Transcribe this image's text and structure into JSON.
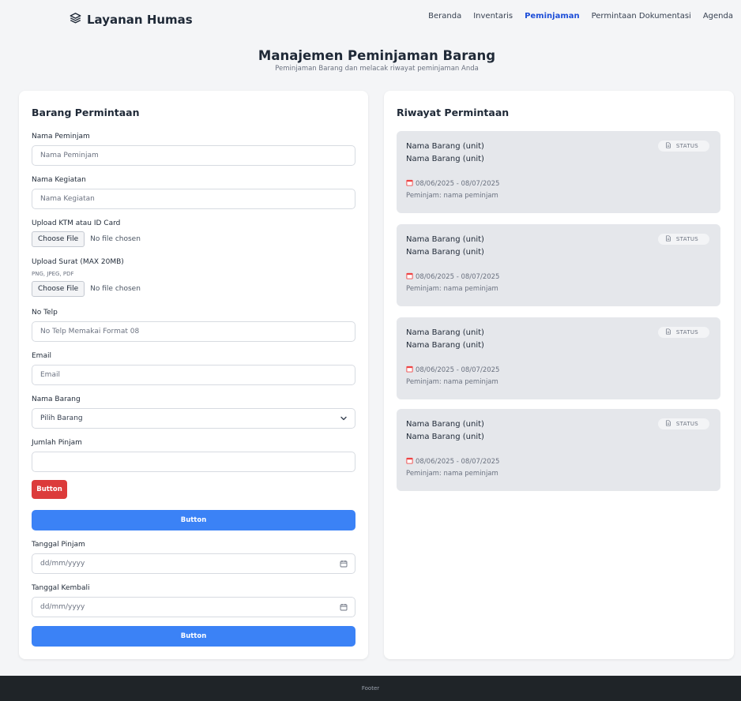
{
  "navbar": {
    "brand": "Layanan Humas",
    "links": [
      "Beranda",
      "Inventaris",
      "Peminjaman",
      "Permintaan Dokumentasi",
      "Agenda"
    ],
    "active_index": 2
  },
  "header": {
    "title": "Manajemen Peminjaman Barang",
    "subtitle": "Peminjaman Barang dan melacak riwayat peminjaman Anda"
  },
  "form": {
    "title": "Barang Permintaan",
    "borrower_label": "Nama Peminjam",
    "borrower_placeholder": "Nama Peminjam",
    "activity_label": "Nama Kegiatan",
    "activity_placeholder": "Nama Kegiatan",
    "ktm_label": "Upload KTM atau ID Card",
    "choose_file": "Choose File",
    "no_file": "No file chosen",
    "letter_label": "Upload Surat (MAX 20MB)",
    "letter_formats": "PNG, JPEG, PDF",
    "phone_label": "No Telp",
    "phone_placeholder": "No Telp Memakai Format 08",
    "email_label": "Email",
    "email_placeholder": "Email",
    "item_label": "Nama Barang",
    "item_selected": "Pilih Barang",
    "qty_label": "Jumlah Pinjam",
    "qty_value": "",
    "red_button": "Button",
    "blue_button_1": "Button",
    "borrow_date_label": "Tanggal Pinjam",
    "return_date_label": "Tanggal Kembali",
    "date_placeholder": "dd/mm/yyyy",
    "blue_button_2": "Button"
  },
  "history": {
    "title": "Riwayat Permintaan",
    "items": [
      {
        "line1": "Nama Barang (unit)",
        "line2": "Nama Barang (unit)",
        "date": "08/06/2025 - 08/07/2025",
        "borrower": "Peminjam: nama peminjam",
        "status": "STATUS"
      },
      {
        "line1": "Nama Barang (unit)",
        "line2": "Nama Barang (unit)",
        "date": "08/06/2025 - 08/07/2025",
        "borrower": "Peminjam: nama peminjam",
        "status": "STATUS"
      },
      {
        "line1": "Nama Barang (unit)",
        "line2": "Nama Barang (unit)",
        "date": "08/06/2025 - 08/07/2025",
        "borrower": "Peminjam: nama peminjam",
        "status": "STATUS"
      },
      {
        "line1": "Nama Barang (unit)",
        "line2": "Nama Barang (unit)",
        "date": "08/06/2025 - 08/07/2025",
        "borrower": "Peminjam: nama peminjam",
        "status": "STATUS"
      }
    ]
  },
  "footer": {
    "text": "Footer"
  },
  "colors": {
    "primary": "#3b82f6",
    "danger": "#dc3b3b",
    "active_nav": "#1d4ed8",
    "footer_bg": "#1f2428"
  }
}
